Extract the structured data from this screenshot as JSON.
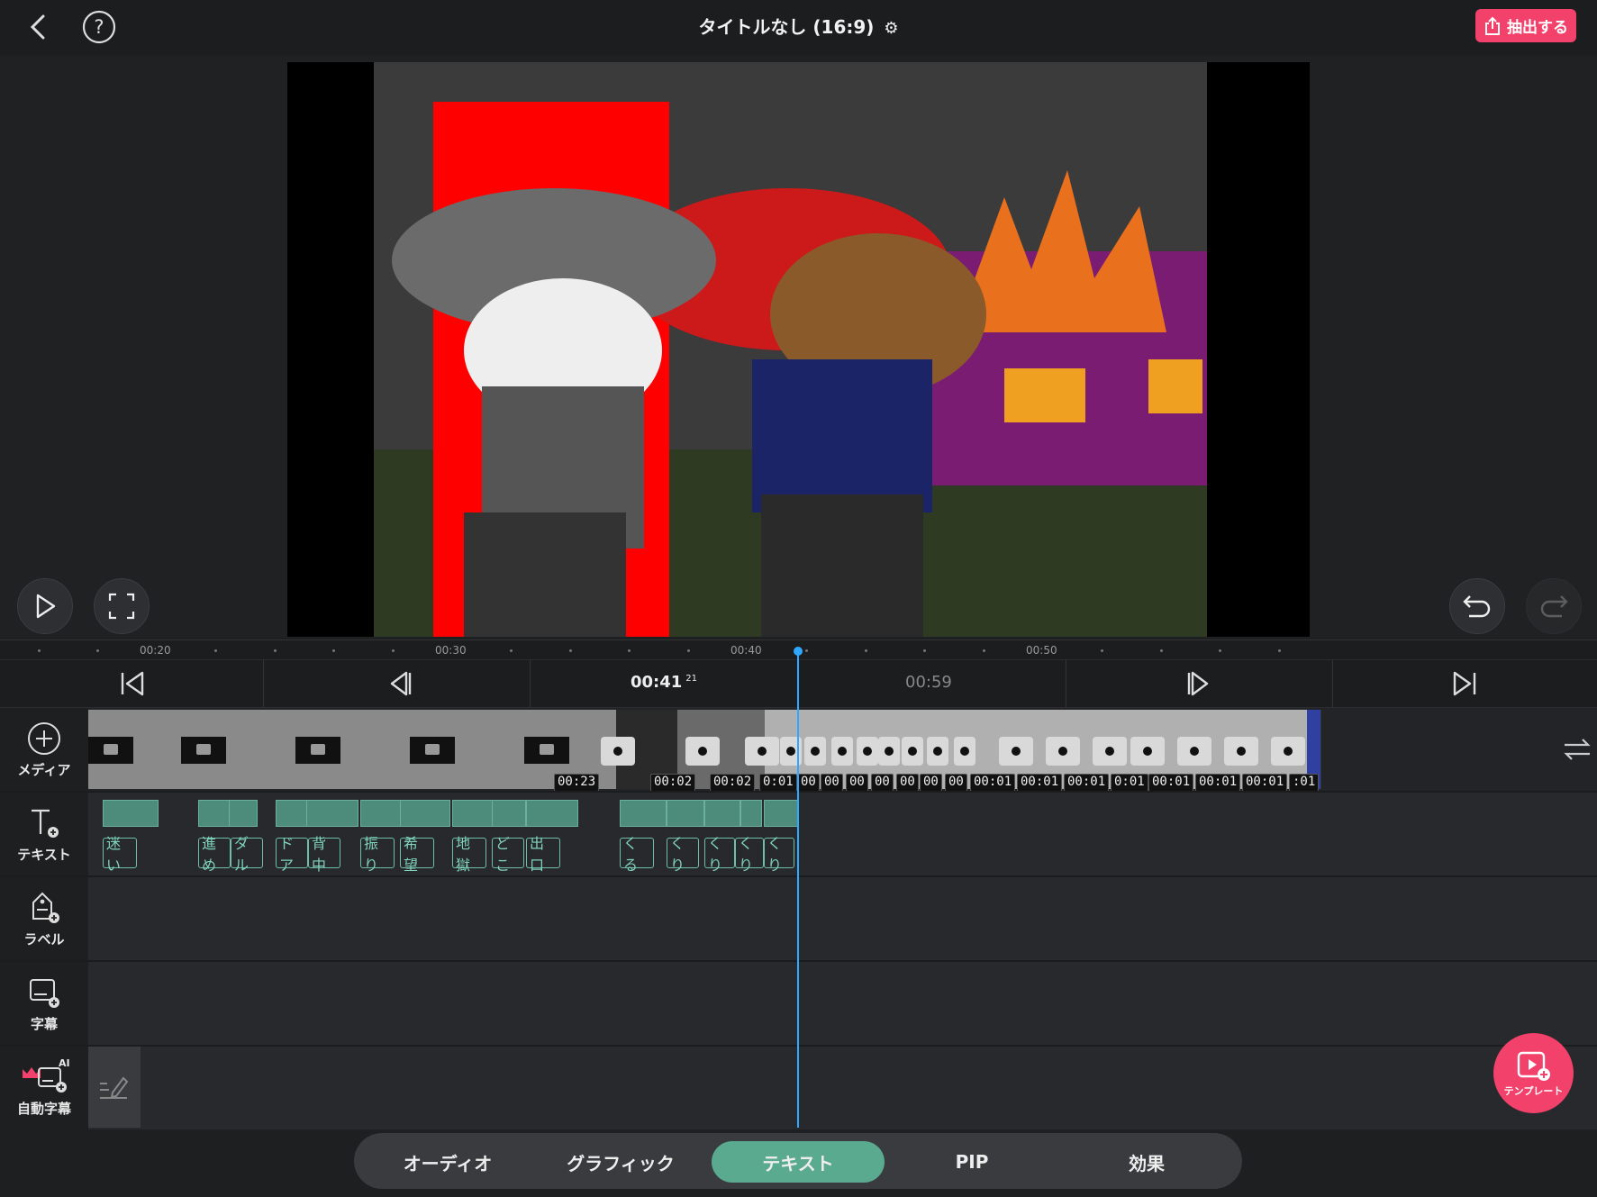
{
  "topbar": {
    "title": "タイトルなし (16:9)",
    "export_label": "抽出する",
    "colors": {
      "accent": "#f2416b"
    }
  },
  "ruler": {
    "labels": [
      "00:20",
      "00:30",
      "00:40",
      "00:50"
    ]
  },
  "transport": {
    "current_time": "00:41",
    "current_frame": "21",
    "total_time": "00:59"
  },
  "tracks": {
    "media": "メディア",
    "text": "テキスト",
    "label": "ラベル",
    "subtitle": "字幕",
    "auto_subtitle": "自動字幕",
    "ai_badge": "AI"
  },
  "media_durations": [
    "00:23",
    "00:02",
    "00:02",
    "0:01",
    "00",
    "00",
    "00",
    "00",
    "00",
    "00",
    "00",
    "00:01",
    "00:01",
    "00:01",
    "0:01",
    "00:01",
    "00:01",
    "00:01",
    ":01"
  ],
  "text_labels": [
    "迷い",
    "進め",
    "ダル",
    "ドア",
    "背中",
    "振り",
    "希望",
    "地獄",
    "どこ",
    "出口",
    "くる",
    "くり",
    "くり",
    "くり",
    "くり"
  ],
  "tabs": [
    "オーディオ",
    "グラフィック",
    "テキスト",
    "PIP",
    "効果"
  ],
  "active_tab": "テキスト",
  "template_label": "テンプレート"
}
